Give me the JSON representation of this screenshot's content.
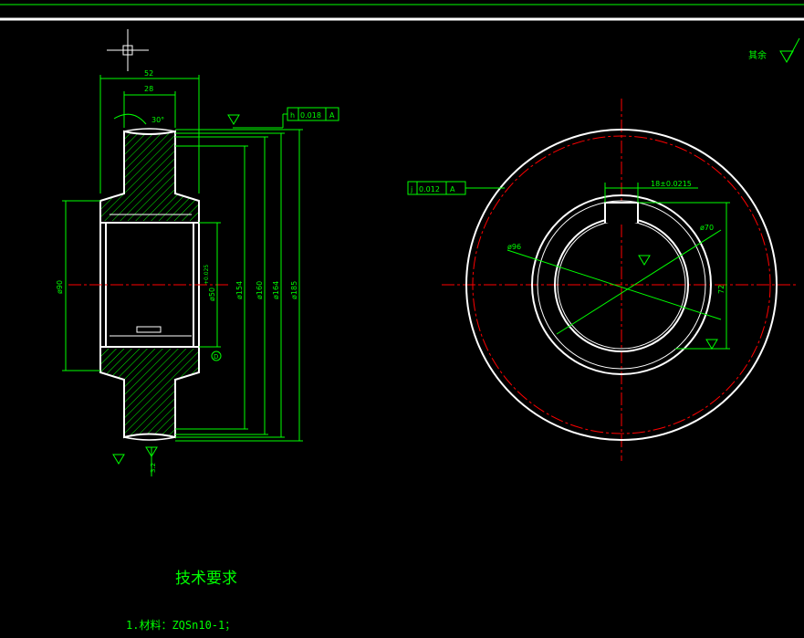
{
  "colors": {
    "background": "#000000",
    "outline": "#ffffff",
    "dimension": "#00ff00",
    "centerline": "#ff0000"
  },
  "side_view": {
    "dims": {
      "width_total": "52",
      "width_hub": "28",
      "angle": "30°",
      "dia_90": "ø90",
      "dia_bore": "ø50",
      "bore_tol": "+0.025",
      "dia_154": "ø154",
      "dia_160": "ø160",
      "dia_164": "ø164",
      "dia_185": "ø185",
      "datum": "D",
      "roughness_bottom": "3.2"
    },
    "tolerance_frame": {
      "symbol": "h",
      "value": "0.018",
      "datum": "A"
    }
  },
  "front_view": {
    "tolerance_frame": {
      "symbol": "j",
      "value": "0.012",
      "datum": "A"
    },
    "dims": {
      "keyway": "18±0.0215",
      "dia_96": "ø96",
      "dia_70": "ø70",
      "keyway_depth": "72"
    }
  },
  "roughness_note": {
    "label": "其余"
  },
  "tech_requirements": {
    "title": "技术要求",
    "items": [
      "1.材料：ZQSn10-1；"
    ]
  }
}
